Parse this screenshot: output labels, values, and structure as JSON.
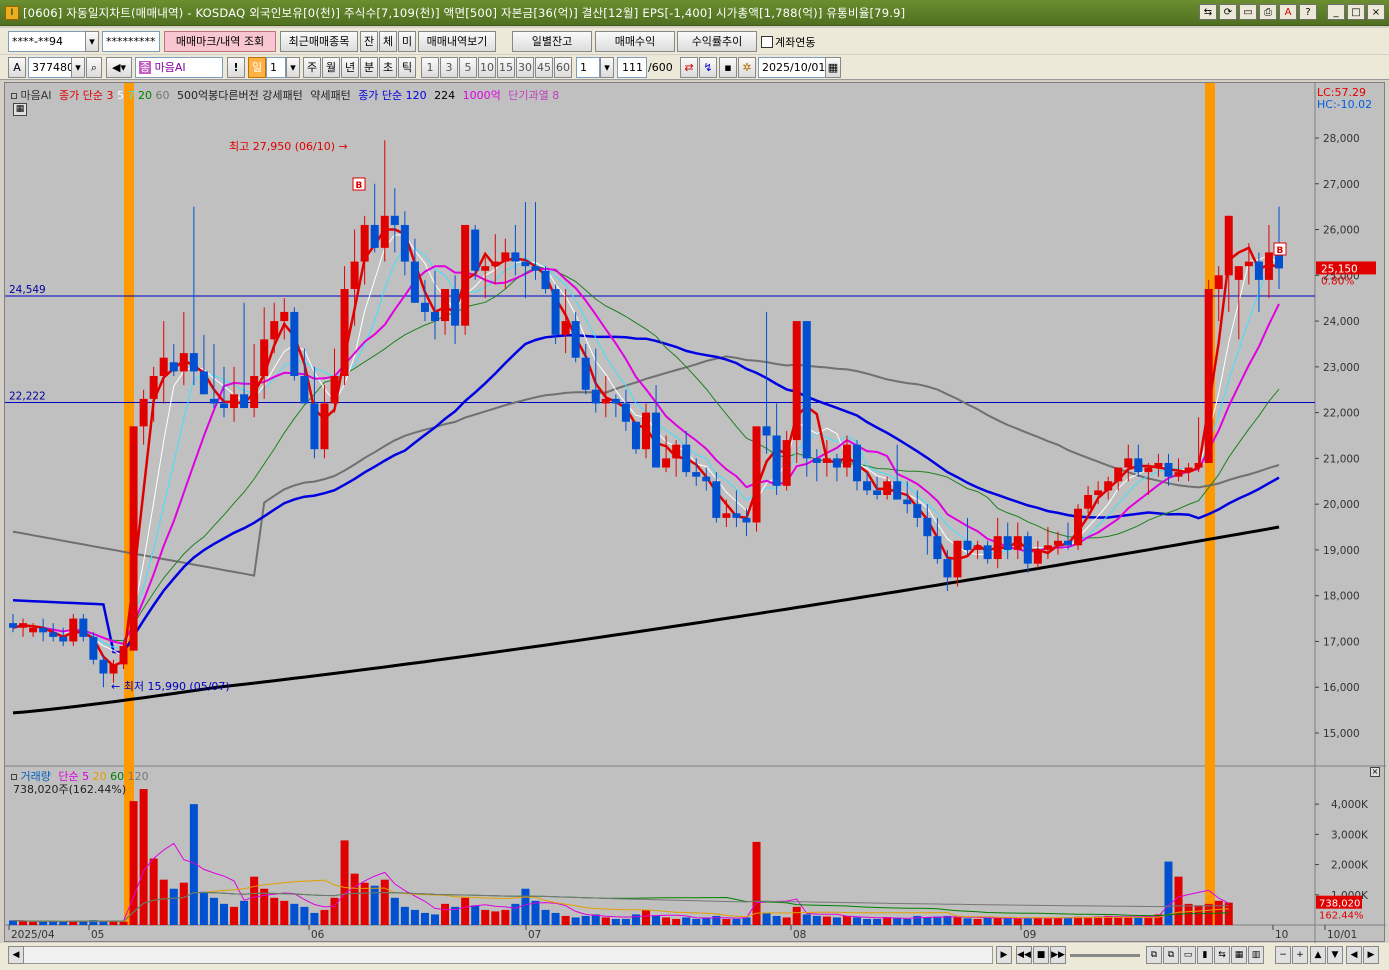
{
  "window": {
    "icon": "I",
    "title": "[0606] 자동일지차트(매매내역) - KOSDAQ 외국인보유[0(천)] 주식수[7,109(천)] 액면[500] 자본금[36(억)] 결산[12월] EPS[-1,400] 시가총액[1,788(억)] 유통비율[79.9]"
  },
  "toolbar1": {
    "account_value": "****-**94",
    "password_value": "*********",
    "mark_btn": "매매마크/내역 조회",
    "recent_btn": "최근매매종목",
    "jan_btn": "잔",
    "che_btn": "체",
    "mi_btn": "미",
    "history_btn": "매매내역보기",
    "daily_btn": "일별잔고",
    "profit_btn": "매매수익",
    "rate_btn": "수익률추이",
    "link_label": "계좌연동"
  },
  "toolbar2": {
    "code": "377480",
    "stock_name": "마음AI",
    "period_active": "일",
    "period_num": "1",
    "periods": [
      "주",
      "월",
      "년",
      "분",
      "초",
      "틱"
    ],
    "intervals": [
      "1",
      "3",
      "5",
      "10",
      "15",
      "30",
      "45",
      "60"
    ],
    "interval_value": "1",
    "count": "111",
    "count_max": "/600",
    "date": "2025/10/01"
  },
  "legend": {
    "name": "마음AI",
    "close_simple": "종가 단순",
    "ma3": "3",
    "ma5": "5",
    "ma7": "7",
    "ma20": "20",
    "ma60": "60",
    "pattern1": "500억봉다른버전",
    "pattern2": "강세패턴",
    "pattern3": "약세패턴",
    "close_simple2": "종가 단순",
    "ma120": "120",
    "ma224": "224",
    "p1000": "1000억",
    "short_over": "단기과열",
    "short_over_val": "8"
  },
  "price_panel": {
    "lc": "LC:57.29",
    "hc": "HC:-10.02",
    "hline1": "24,549",
    "hline2": "22,222",
    "max_label": "최고 27,950 (06/10)",
    "min_label": "최저 15,990 (05/07)",
    "last_price": "25,150",
    "last_change": "0.80%",
    "y_ticks": [
      "28,000",
      "27,000",
      "26,000",
      "25,000",
      "24,000",
      "23,000",
      "22,000",
      "21,000",
      "20,000",
      "19,000",
      "18,000",
      "17,000",
      "16,000",
      "15,000"
    ]
  },
  "volume_panel": {
    "title": "거래량",
    "simple": "단순",
    "v5": "5",
    "v20": "20",
    "v60": "60",
    "v120": "120",
    "current": "738,020주(162.44%)",
    "last_vol": "738,020",
    "last_pct": "162.44%",
    "y_ticks": [
      "4,000K",
      "3,000K",
      "2,000K",
      "1,000K"
    ]
  },
  "x_labels": [
    "2025/04",
    "05",
    "06",
    "07",
    "08",
    "09",
    "10",
    "10/01"
  ],
  "chart_data": {
    "type": "candlestick",
    "x_labels": [
      "2025/04",
      "05",
      "06",
      "07",
      "08",
      "09",
      "10"
    ],
    "ylim": [
      14500,
      28500
    ],
    "candles": [
      [
        17400,
        17600,
        17200,
        17300
      ],
      [
        17300,
        17500,
        17100,
        17400
      ],
      [
        17200,
        17400,
        17100,
        17300
      ],
      [
        17300,
        17500,
        17000,
        17200
      ],
      [
        17200,
        17400,
        17000,
        17100
      ],
      [
        17100,
        17300,
        16900,
        17000
      ],
      [
        17000,
        17600,
        16900,
        17500
      ],
      [
        17500,
        17600,
        17000,
        17100
      ],
      [
        17100,
        17200,
        16500,
        16600
      ],
      [
        16600,
        16700,
        16000,
        16300
      ],
      [
        16300,
        16600,
        16100,
        16500
      ],
      [
        16500,
        17000,
        16400,
        16900
      ],
      [
        16800,
        21700,
        16800,
        21700
      ],
      [
        21700,
        22500,
        21300,
        22300
      ],
      [
        22300,
        23000,
        21800,
        22800
      ],
      [
        22800,
        24000,
        22200,
        23200
      ],
      [
        23100,
        23500,
        22800,
        22900
      ],
      [
        22900,
        24200,
        22600,
        23300
      ],
      [
        23300,
        26500,
        22600,
        22900
      ],
      [
        22900,
        23700,
        22500,
        22400
      ],
      [
        22300,
        23500,
        22100,
        22200
      ],
      [
        22200,
        23000,
        21900,
        22100
      ],
      [
        22100,
        23000,
        21800,
        22400
      ],
      [
        22400,
        24400,
        22100,
        22100
      ],
      [
        22100,
        23500,
        21900,
        22800
      ],
      [
        22800,
        24300,
        22300,
        23600
      ],
      [
        23600,
        24400,
        23300,
        24000
      ],
      [
        24000,
        24500,
        23600,
        24200
      ],
      [
        24200,
        24300,
        22700,
        22800
      ],
      [
        22800,
        23400,
        22200,
        22200
      ],
      [
        22200,
        23000,
        21000,
        21200
      ],
      [
        21200,
        22600,
        21000,
        22200
      ],
      [
        22200,
        23400,
        22000,
        22800
      ],
      [
        22800,
        25200,
        22600,
        24700
      ],
      [
        24700,
        26000,
        23900,
        25300
      ],
      [
        25300,
        26300,
        24800,
        26100
      ],
      [
        26100,
        27000,
        25500,
        25600
      ],
      [
        25600,
        27950,
        25300,
        26300
      ],
      [
        26300,
        26900,
        25500,
        26100
      ],
      [
        26100,
        26400,
        25000,
        25300
      ],
      [
        25300,
        25800,
        24400,
        24400
      ],
      [
        24400,
        24900,
        24000,
        24200
      ],
      [
        24200,
        25100,
        23600,
        24000
      ],
      [
        24000,
        24700,
        23700,
        24700
      ],
      [
        24700,
        25000,
        23500,
        23900
      ],
      [
        23900,
        26100,
        23700,
        26100
      ],
      [
        26000,
        26100,
        24900,
        25100
      ],
      [
        25100,
        25400,
        24500,
        25200
      ],
      [
        25200,
        25900,
        24800,
        25300
      ],
      [
        25300,
        25800,
        24700,
        25500
      ],
      [
        25500,
        26100,
        25000,
        25300
      ],
      [
        25300,
        26600,
        24500,
        25200
      ],
      [
        25200,
        26600,
        24900,
        25100
      ],
      [
        25100,
        25200,
        24600,
        24700
      ],
      [
        24700,
        24800,
        23500,
        23700
      ],
      [
        23700,
        24700,
        23300,
        24000
      ],
      [
        24000,
        24200,
        23100,
        23200
      ],
      [
        23200,
        23500,
        22400,
        22500
      ],
      [
        22500,
        23400,
        22000,
        22200
      ],
      [
        22200,
        22800,
        21900,
        22300
      ],
      [
        22300,
        22400,
        21900,
        22200
      ],
      [
        22200,
        22500,
        21600,
        21800
      ],
      [
        21800,
        21800,
        21100,
        21200
      ],
      [
        21200,
        22200,
        21000,
        22000
      ],
      [
        22000,
        22600,
        20800,
        20800
      ],
      [
        20800,
        21500,
        20700,
        21000
      ],
      [
        21000,
        21400,
        20600,
        21300
      ],
      [
        21300,
        21600,
        20600,
        20700
      ],
      [
        20700,
        21000,
        20400,
        20600
      ],
      [
        20600,
        20800,
        20300,
        20500
      ],
      [
        20500,
        20700,
        19600,
        19700
      ],
      [
        19700,
        20100,
        19500,
        19800
      ],
      [
        19800,
        20300,
        19500,
        19700
      ],
      [
        19700,
        19900,
        19300,
        19600
      ],
      [
        19600,
        21700,
        19400,
        21700
      ],
      [
        21700,
        24200,
        21100,
        21500
      ],
      [
        21500,
        22200,
        20200,
        20400
      ],
      [
        20400,
        21600,
        20300,
        21400
      ],
      [
        21400,
        24000,
        20900,
        24000
      ],
      [
        24000,
        22400,
        20600,
        21000
      ],
      [
        21000,
        21200,
        20500,
        20900
      ],
      [
        20900,
        21400,
        20600,
        21000
      ],
      [
        21000,
        21100,
        20500,
        20800
      ],
      [
        20800,
        21500,
        20600,
        21300
      ],
      [
        21300,
        21400,
        20300,
        20500
      ],
      [
        20500,
        20700,
        20200,
        20300
      ],
      [
        20300,
        20600,
        20100,
        20200
      ],
      [
        20200,
        20600,
        20100,
        20500
      ],
      [
        20500,
        21300,
        20100,
        20100
      ],
      [
        20100,
        20500,
        19800,
        20000
      ],
      [
        20000,
        20300,
        19500,
        19700
      ],
      [
        19700,
        20000,
        18900,
        19300
      ],
      [
        19300,
        19700,
        18700,
        18800
      ],
      [
        18800,
        19000,
        18100,
        18400
      ],
      [
        18400,
        19200,
        18200,
        19200
      ],
      [
        19200,
        19700,
        18900,
        19000
      ],
      [
        19000,
        19200,
        18800,
        19100
      ],
      [
        19100,
        19200,
        18700,
        18800
      ],
      [
        18800,
        19700,
        18600,
        19300
      ],
      [
        19300,
        19600,
        18800,
        19000
      ],
      [
        19000,
        19600,
        18800,
        19300
      ],
      [
        19300,
        19400,
        18500,
        18700
      ],
      [
        18700,
        19200,
        18600,
        19000
      ],
      [
        19000,
        19500,
        18800,
        19100
      ],
      [
        19100,
        19400,
        18900,
        19200
      ],
      [
        19200,
        19600,
        19000,
        19100
      ],
      [
        19100,
        20000,
        19000,
        19900
      ],
      [
        19900,
        20400,
        19800,
        20200
      ],
      [
        20200,
        20500,
        20000,
        20300
      ],
      [
        20300,
        20600,
        20100,
        20500
      ],
      [
        20500,
        20800,
        20300,
        20800
      ],
      [
        20800,
        21300,
        20500,
        21000
      ],
      [
        21000,
        21300,
        20600,
        20700
      ],
      [
        20700,
        20900,
        20200,
        20800
      ],
      [
        20800,
        21100,
        20600,
        20900
      ],
      [
        20900,
        21100,
        20400,
        20600
      ],
      [
        20600,
        21000,
        20500,
        20700
      ],
      [
        20700,
        20900,
        20500,
        20800
      ],
      [
        20800,
        21900,
        20700,
        20900
      ],
      [
        20900,
        24900,
        20900,
        24700
      ],
      [
        24700,
        25200,
        24000,
        25000
      ],
      [
        25000,
        26300,
        24200,
        26300
      ],
      [
        24900,
        25200,
        23600,
        25200
      ],
      [
        25200,
        25700,
        24800,
        25300
      ],
      [
        25300,
        25500,
        24200,
        24900
      ],
      [
        24900,
        26100,
        24500,
        25500
      ],
      [
        25500,
        26500,
        24700,
        25150
      ]
    ],
    "volumes": [
      150,
      120,
      100,
      140,
      110,
      100,
      130,
      120,
      160,
      140,
      120,
      110,
      4100,
      4500,
      2200,
      1500,
      1200,
      1400,
      4000,
      1100,
      900,
      700,
      600,
      800,
      1600,
      1200,
      900,
      800,
      700,
      600,
      400,
      500,
      900,
      2800,
      1700,
      1400,
      1300,
      1500,
      900,
      600,
      500,
      400,
      350,
      700,
      600,
      900,
      650,
      500,
      450,
      500,
      700,
      1200,
      800,
      500,
      400,
      300,
      250,
      300,
      350,
      250,
      200,
      200,
      350,
      500,
      300,
      250,
      200,
      250,
      200,
      250,
      300,
      200,
      200,
      250,
      2750,
      400,
      300,
      250,
      600,
      350,
      300,
      280,
      250,
      300,
      250,
      200,
      200,
      260,
      240,
      200,
      300,
      250,
      280,
      300,
      250,
      220,
      200,
      240,
      260,
      220,
      210,
      230,
      250,
      240,
      230,
      250,
      270,
      260,
      280,
      300,
      280,
      250,
      260,
      300,
      350,
      2100,
      1600,
      700,
      650,
      700,
      800,
      740
    ]
  }
}
